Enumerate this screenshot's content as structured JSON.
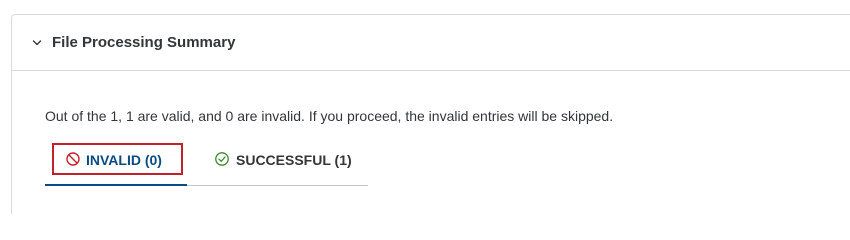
{
  "panel": {
    "title": "File Processing Summary",
    "collapse_icon": "chevron-down-icon"
  },
  "summary": {
    "text": "Out of the 1, 1 are valid, and 0 are invalid. If you proceed, the invalid entries will be skipped."
  },
  "tabs": [
    {
      "label": "INVALID (0)",
      "icon": "prohibited-icon",
      "active": true,
      "color": "#0a4b83",
      "icon_color": "#c1222c"
    },
    {
      "label": "SUCCESSFUL (1)",
      "icon": "check-circle-icon",
      "active": false,
      "color": "#32363a",
      "icon_color": "#3a8a2c"
    }
  ],
  "colors": {
    "accent": "#0a4b83",
    "highlight_border": "#c1222c",
    "success": "#3a8a2c",
    "border": "#d9d9d9"
  }
}
